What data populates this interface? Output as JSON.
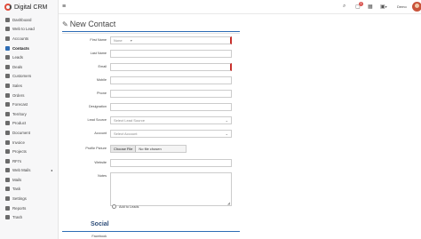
{
  "app": {
    "brand_name": "Digital CRM"
  },
  "sidebar": {
    "items": [
      {
        "label": "Dashboard"
      },
      {
        "label": "Web to Lead"
      },
      {
        "label": "Accounts"
      },
      {
        "label": "Contacts",
        "active": true
      },
      {
        "label": "Leads"
      },
      {
        "label": "Deals"
      },
      {
        "label": "Customers"
      },
      {
        "label": "Sales"
      },
      {
        "label": "Orders"
      },
      {
        "label": "Forecast"
      },
      {
        "label": "Territory"
      },
      {
        "label": "Product"
      },
      {
        "label": "Document"
      },
      {
        "label": "Invoice"
      },
      {
        "label": "Projects"
      },
      {
        "label": "RFI's"
      },
      {
        "label": "Web Mails",
        "caret": "◂"
      },
      {
        "label": "Mails"
      },
      {
        "label": "Task"
      },
      {
        "label": "Settings"
      },
      {
        "label": "Reports"
      },
      {
        "label": "Trash"
      }
    ]
  },
  "topbar": {
    "menu_icon": "hamburger-icon",
    "search_icon": "search-icon",
    "notification_icon": "bell-icon",
    "notification_count": "1",
    "calendar_icon": "calendar-icon",
    "grid_icon": "grid-icon",
    "user_name": "Demo",
    "user_caret": "▾"
  },
  "page": {
    "title": "New Contact",
    "title_icon": "edit-icon"
  },
  "form": {
    "first_name": {
      "label": "First Name",
      "placeholder": "None",
      "caret": "▾"
    },
    "last_name": {
      "label": "Last Name",
      "value": ""
    },
    "email": {
      "label": "Email",
      "value": ""
    },
    "mobile": {
      "label": "Mobile",
      "value": ""
    },
    "phone": {
      "label": "Phone",
      "value": ""
    },
    "designation": {
      "label": "Designation",
      "value": ""
    },
    "lead_source": {
      "label": "Lead Source",
      "placeholder": "Select Lead Source"
    },
    "account": {
      "label": "Account",
      "placeholder": "Select Account"
    },
    "profile_picture": {
      "label": "Profile Picture",
      "button": "Choose File",
      "status": "No file chosen"
    },
    "website": {
      "label": "Website",
      "value": ""
    },
    "notes": {
      "label": "Notes",
      "value": ""
    },
    "add_to_leads": "Add to Leads"
  },
  "social": {
    "title": "Social",
    "facebook_label": "Facebook"
  },
  "colors": {
    "accent": "#2d6cb5",
    "required": "#c9302c",
    "section_title": "#2f4e7a"
  }
}
